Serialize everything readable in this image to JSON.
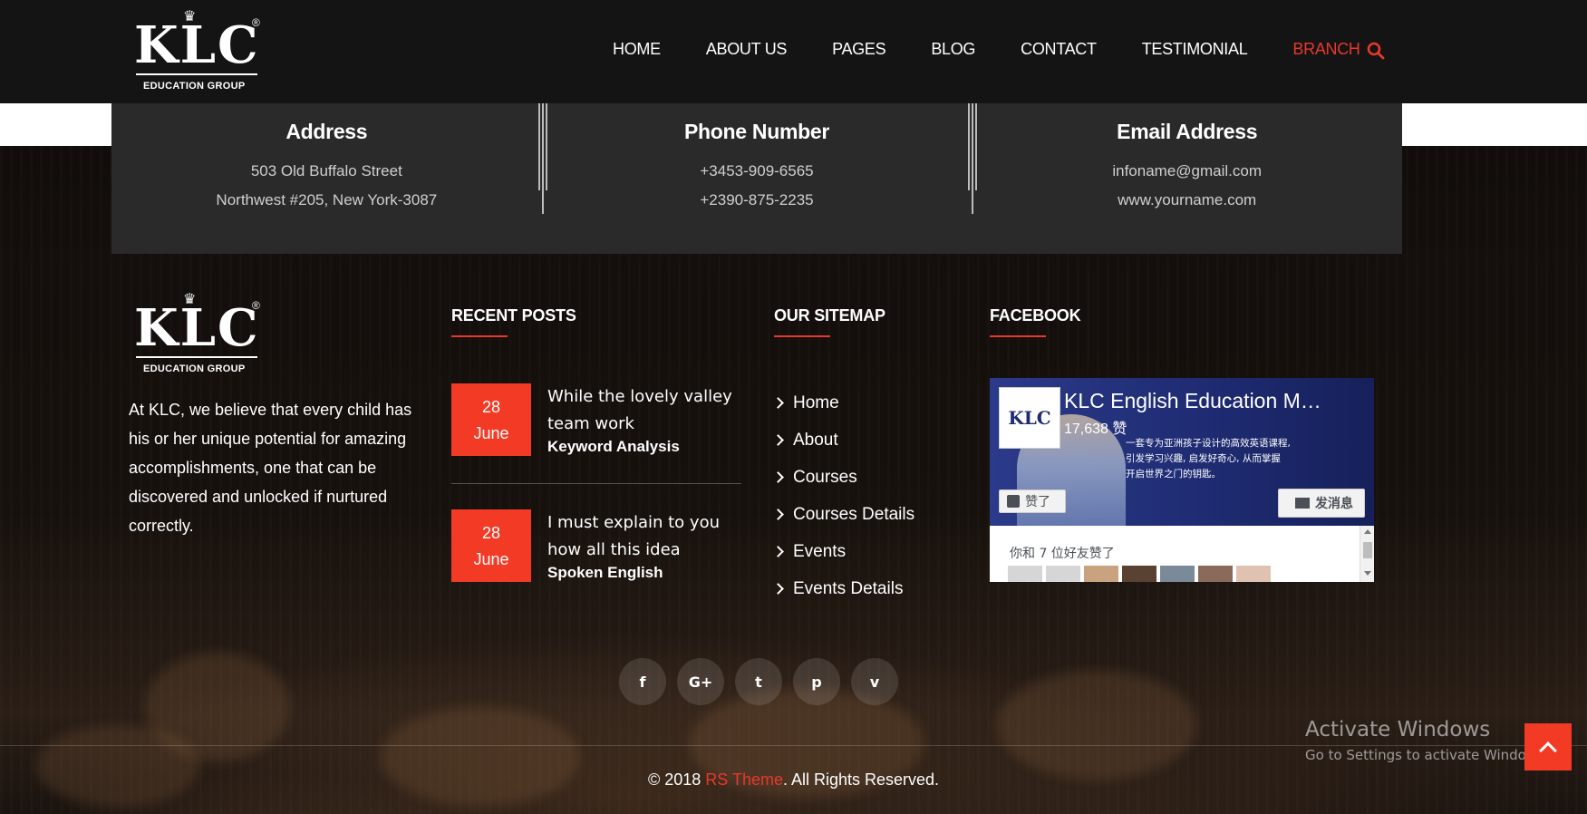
{
  "header": {
    "logo_text": "KLC",
    "logo_subtitle": "EDUCATION GROUP",
    "nav": [
      {
        "label": "HOME"
      },
      {
        "label": "ABOUT US"
      },
      {
        "label": "PAGES"
      },
      {
        "label": "BLOG"
      },
      {
        "label": "CONTACT"
      },
      {
        "label": "TESTIMONIAL"
      },
      {
        "label": "BRANCH",
        "active": true
      }
    ]
  },
  "contact": {
    "address": {
      "title": "Address",
      "line1": "503 Old Buffalo Street",
      "line2": "Northwest #205, New York-3087"
    },
    "phone": {
      "title": "Phone Number",
      "line1": "+3453-909-6565",
      "line2": "+2390-875-2235"
    },
    "email": {
      "title": "Email Address",
      "line1": "infoname@gmail.com",
      "line2": "www.yourname.com"
    }
  },
  "footer": {
    "about_text": "At KLC, we believe that every child has his or her unique potential for amazing accomplishments, one that can be discovered and unlocked if nurtured correctly.",
    "recent_posts_title": "RECENT POSTS",
    "posts": [
      {
        "day": "28",
        "month": "June",
        "title": "While the lovely valley team work",
        "category": "Keyword Analysis"
      },
      {
        "day": "28",
        "month": "June",
        "title": "I must explain to you how all this idea",
        "category": "Spoken English"
      }
    ],
    "sitemap_title": "OUR SITEMAP",
    "sitemap": [
      "Home",
      "About",
      "Courses",
      "Courses Details",
      "Events",
      "Events Details"
    ],
    "facebook_title": "FACEBOOK",
    "facebook": {
      "page_name": "KLC English Education M…",
      "likes": "17,638 赞",
      "tagline1": "一套专为亚洲孩子设计的高效英语课程,",
      "tagline2": "引发学习兴趣, 启发好奇心, 从而掌握",
      "tagline3": "开启世界之门的钥匙。",
      "like_button": "赞了",
      "message_button": "发消息",
      "friends_text": "你和 7 位好友赞了"
    }
  },
  "social": [
    {
      "icon": "facebook-icon",
      "glyph": "f"
    },
    {
      "icon": "google-plus-icon",
      "glyph": "G+"
    },
    {
      "icon": "twitter-icon",
      "glyph": "t"
    },
    {
      "icon": "pinterest-icon",
      "glyph": "p"
    },
    {
      "icon": "vimeo-icon",
      "glyph": "v"
    }
  ],
  "copyright": {
    "prefix": "© 2018 ",
    "brand": "RS Theme",
    "suffix": ". All Rights Reserved."
  },
  "windows_watermark": {
    "line1": "Activate Windows",
    "line2": "Go to Settings to activate Windows."
  },
  "colors": {
    "accent": "#e8382c",
    "date_badge": "#f23a25",
    "header_bg": "#141414",
    "contact_bg": "#2a2a2a"
  }
}
